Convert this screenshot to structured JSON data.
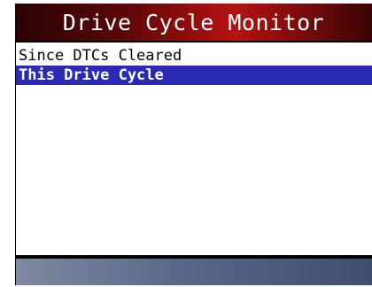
{
  "header": {
    "title": "Drive Cycle Monitor"
  },
  "menu": {
    "items": [
      {
        "label": "Since DTCs Cleared",
        "selected": false
      },
      {
        "label": "This Drive Cycle",
        "selected": true
      }
    ]
  },
  "colors": {
    "selection": "#2a2ab4",
    "title_bar": "#b51212",
    "status_bar": "#59688a"
  }
}
